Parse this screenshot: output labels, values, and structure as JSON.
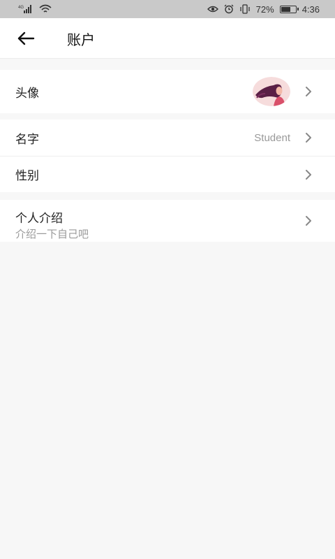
{
  "status_bar": {
    "network_label": "4G",
    "battery_percent_text": "72%",
    "battery_level": 0.72,
    "time": "4:36",
    "icons": [
      "signal-icon",
      "wifi-icon",
      "eye-icon",
      "alarm-icon",
      "vibrate-icon",
      "battery-icon"
    ]
  },
  "appbar": {
    "back_icon": "arrow-left-icon",
    "title": "账户"
  },
  "rows": {
    "avatar": {
      "label": "头像"
    },
    "name": {
      "label": "名字",
      "value": "Student"
    },
    "gender": {
      "label": "性别"
    },
    "intro": {
      "label": "个人介绍",
      "placeholder": "介绍一下自己吧"
    }
  },
  "colors": {
    "status_bar_bg": "#c9c9c9",
    "page_bg": "#f7f7f7",
    "card_bg": "#ffffff",
    "secondary_text": "#999999",
    "chevron": "#888888"
  }
}
